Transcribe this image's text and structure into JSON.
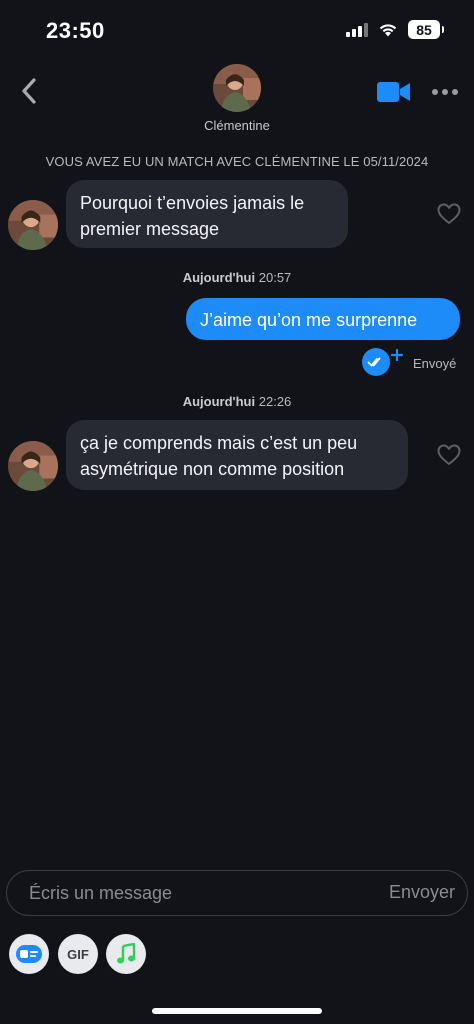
{
  "status_bar": {
    "time": "23:50",
    "battery": "85"
  },
  "header": {
    "contact_name": "Clémentine",
    "icons": [
      "back-chevron-icon",
      "video-camera-icon",
      "more-dots-icon"
    ],
    "accent_color": "#1d8cf8"
  },
  "match_banner": "VOUS AVEZ EU UN MATCH AVEC CLÉMENTINE LE 05/11/2024",
  "messages": [
    {
      "direction": "incoming",
      "lines": [
        "Pourquoi t’envoies jamais le",
        "premier message"
      ]
    },
    {
      "type": "timestamp",
      "day": "Aujourd'hui",
      "time": "20:57"
    },
    {
      "direction": "outgoing",
      "text": "J’aime qu’on me surprenne",
      "status": "Envoyé"
    },
    {
      "type": "timestamp",
      "day": "Aujourd'hui",
      "time": "22:26"
    },
    {
      "direction": "incoming",
      "lines": [
        "ça je comprends mais c’est un peu",
        "asymétrique non comme position"
      ]
    }
  ],
  "composer": {
    "placeholder": "Écris un message",
    "send_label": "Envoyer"
  },
  "toolbar": {
    "gif_label": "GIF",
    "icons": [
      "sticker-card-icon",
      "gif-icon",
      "music-note-icon"
    ]
  },
  "colors": {
    "background": "#111318",
    "incoming_bubble": "#272a33",
    "outgoing_bubble": "#1d8cf8",
    "music_green": "#2fcf5b"
  }
}
